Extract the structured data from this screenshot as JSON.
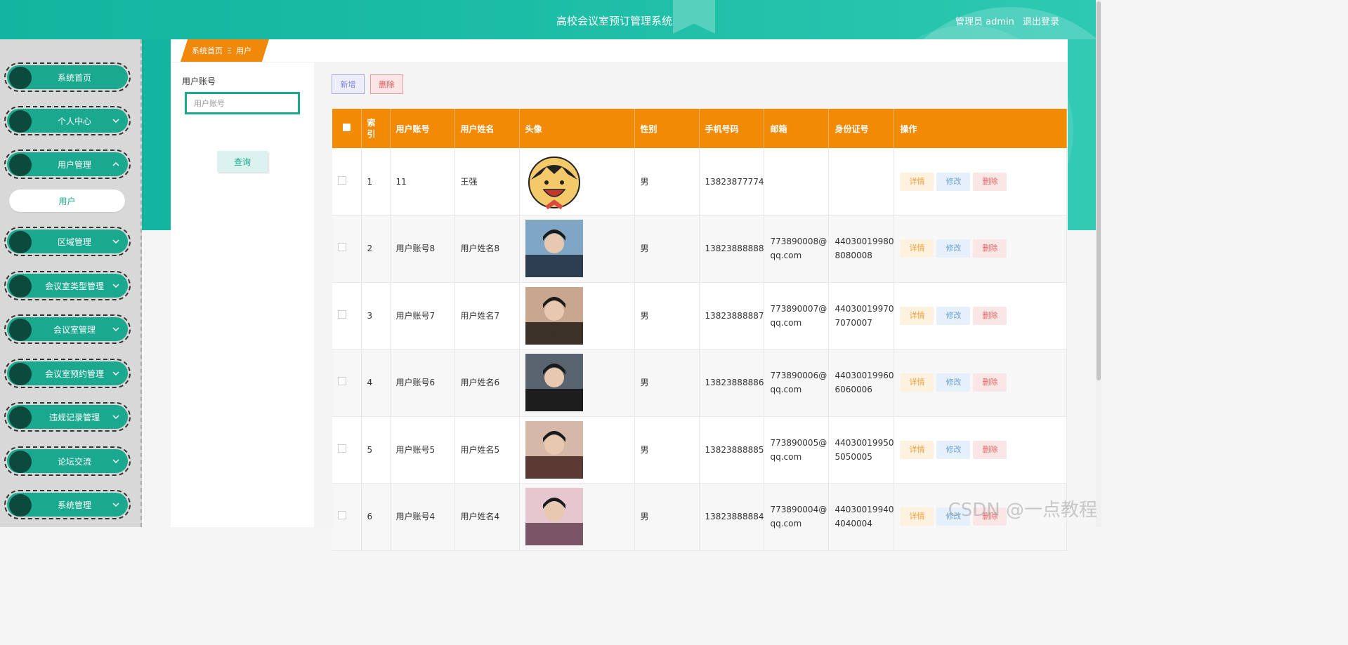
{
  "header": {
    "title": "高校会议室预订管理系统",
    "user_role": "管理员 admin",
    "logout": "退出登录"
  },
  "sidebar": {
    "items": [
      {
        "label": "系统首页",
        "has_chevron": false
      },
      {
        "label": "个人中心",
        "has_chevron": true,
        "chevron": "down"
      },
      {
        "label": "用户管理",
        "has_chevron": true,
        "chevron": "up"
      },
      {
        "label": "区域管理",
        "has_chevron": true,
        "chevron": "down"
      },
      {
        "label": "会议室类型管理",
        "has_chevron": true,
        "chevron": "down"
      },
      {
        "label": "会议室管理",
        "has_chevron": true,
        "chevron": "down"
      },
      {
        "label": "会议室预约管理",
        "has_chevron": true,
        "chevron": "down"
      },
      {
        "label": "违规记录管理",
        "has_chevron": true,
        "chevron": "down"
      },
      {
        "label": "论坛交流",
        "has_chevron": true,
        "chevron": "down"
      },
      {
        "label": "系统管理",
        "has_chevron": true,
        "chevron": "down"
      }
    ],
    "submenu_active": "用户"
  },
  "breadcrumb": {
    "home": "系统首页",
    "separator": "Ξ",
    "current": "用户"
  },
  "search": {
    "label": "用户账号",
    "placeholder": "用户账号",
    "button": "查询"
  },
  "toolbar": {
    "add": "新增",
    "delete": "删除"
  },
  "table": {
    "headers": [
      "索引",
      "用户账号",
      "用户姓名",
      "头像",
      "性别",
      "手机号码",
      "邮箱",
      "身份证号",
      "操作"
    ],
    "header_index_line1": "索",
    "header_index_line2": "引",
    "ops": {
      "detail": "详情",
      "edit": "修改",
      "delete": "删除"
    },
    "rows": [
      {
        "index": "1",
        "account": "11",
        "name": "王强",
        "avatar": "cartoon-avatar",
        "gender": "男",
        "phone": "13823877774",
        "email_1": "",
        "email_2": "",
        "id_1": "",
        "id_2": ""
      },
      {
        "index": "2",
        "account": "用户账号8",
        "name": "用户姓名8",
        "avatar": "photo-avatar",
        "gender": "男",
        "phone": "13823888888",
        "email_1": "773890008@",
        "email_2": "qq.com",
        "id_1": "44030019980",
        "id_2": "8080008"
      },
      {
        "index": "3",
        "account": "用户账号7",
        "name": "用户姓名7",
        "avatar": "photo-avatar",
        "gender": "男",
        "phone": "13823888887",
        "email_1": "773890007@",
        "email_2": "qq.com",
        "id_1": "44030019970",
        "id_2": "7070007"
      },
      {
        "index": "4",
        "account": "用户账号6",
        "name": "用户姓名6",
        "avatar": "photo-avatar",
        "gender": "男",
        "phone": "13823888886",
        "email_1": "773890006@",
        "email_2": "qq.com",
        "id_1": "44030019960",
        "id_2": "6060006"
      },
      {
        "index": "5",
        "account": "用户账号5",
        "name": "用户姓名5",
        "avatar": "photo-avatar",
        "gender": "男",
        "phone": "13823888885",
        "email_1": "773890005@",
        "email_2": "qq.com",
        "id_1": "44030019950",
        "id_2": "5050005"
      },
      {
        "index": "6",
        "account": "用户账号4",
        "name": "用户姓名4",
        "avatar": "photo-avatar",
        "gender": "男",
        "phone": "13823888884",
        "email_1": "773890004@",
        "email_2": "qq.com",
        "id_1": "44030019940",
        "id_2": "4040004"
      }
    ]
  },
  "watermark": "CSDN @一点教程",
  "colors": {
    "teal": "#1aa98f",
    "orange": "#f28a06",
    "knob": "#0b4a3c"
  }
}
